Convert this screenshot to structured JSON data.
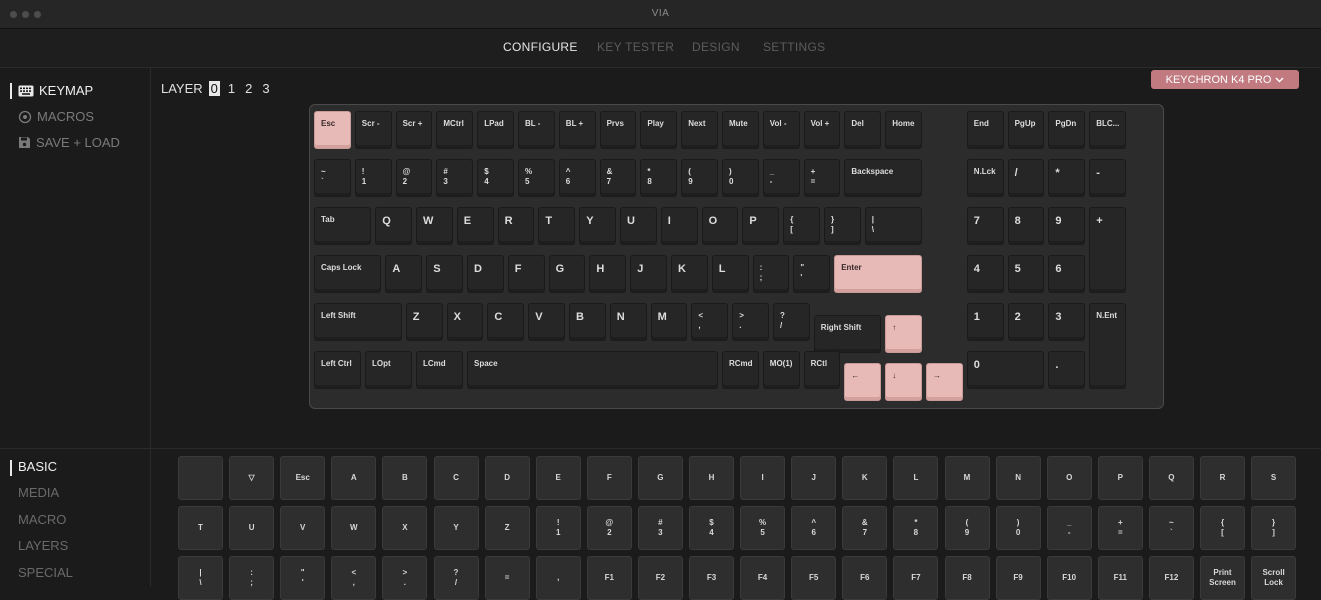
{
  "window": {
    "title": "VIA"
  },
  "nav": {
    "tabs": [
      "CONFIGURE",
      "KEY TESTER",
      "DESIGN",
      "SETTINGS"
    ],
    "active": "CONFIGURE"
  },
  "sidebar": {
    "items": [
      {
        "label": "KEYMAP",
        "icon": "keyboard-icon",
        "active": true
      },
      {
        "label": "MACROS",
        "icon": "target-circle-icon",
        "active": false
      },
      {
        "label": "SAVE + LOAD",
        "icon": "floppy-disk-icon",
        "active": false
      }
    ]
  },
  "layers": {
    "label": "LAYER",
    "items": [
      "0",
      "1",
      "2",
      "3"
    ],
    "active": "0"
  },
  "device": {
    "name": "KEYCHRON K4 PRO",
    "icon": "chevron-down-icon"
  },
  "colors": {
    "accent_pink": "#e7bab7",
    "device_button": "#c07a80",
    "background": "#1b1b1b"
  },
  "keyboard": {
    "rows": [
      [
        "Esc",
        "Scr -",
        "Scr +",
        "MCtrl",
        "LPad",
        "BL -",
        "BL +",
        "Prvs",
        "Play",
        "Next",
        "Mute",
        "Vol -",
        "Vol +",
        "Del",
        "Home",
        "End",
        "PgUp",
        "PgDn",
        "BLC..."
      ],
      [
        "~\n`",
        "!\n1",
        "@\n2",
        "#\n3",
        "$\n4",
        "%\n5",
        "^\n6",
        "&\n7",
        "*\n8",
        "(\n9",
        ")\n0",
        "_\n-",
        "+\n=",
        "Backspace",
        "N.Lck",
        "/",
        "*",
        "-"
      ],
      [
        "Tab",
        "Q",
        "W",
        "E",
        "R",
        "T",
        "Y",
        "U",
        "I",
        "O",
        "P",
        "{\n[",
        "}\n]",
        "|\n\\",
        "7",
        "8",
        "9",
        "+"
      ],
      [
        "Caps Lock",
        "A",
        "S",
        "D",
        "F",
        "G",
        "H",
        "J",
        "K",
        "L",
        ":\n;",
        "\"\n'",
        "Enter",
        "4",
        "5",
        "6"
      ],
      [
        "Left Shift",
        "Z",
        "X",
        "C",
        "V",
        "B",
        "N",
        "M",
        "<\n,",
        ">\n.",
        "?\n/",
        "Right Shift",
        "↑",
        "1",
        "2",
        "3",
        "N.Ent"
      ],
      [
        "Left Ctrl",
        "LOpt",
        "LCmd",
        "Space",
        "RCmd",
        "MO(1)",
        "RCtl",
        "←",
        "↓",
        "→",
        "0",
        "."
      ]
    ]
  },
  "picker": {
    "categories": [
      "BASIC",
      "MEDIA",
      "MACRO",
      "LAYERS",
      "SPECIAL"
    ],
    "active": "BASIC",
    "rows": [
      [
        "",
        "▽",
        "Esc",
        "A",
        "B",
        "C",
        "D",
        "E",
        "F",
        "G",
        "H",
        "I",
        "J",
        "K",
        "L",
        "M",
        "N",
        "O",
        "P",
        "Q",
        "R",
        "S"
      ],
      [
        "T",
        "U",
        "V",
        "W",
        "X",
        "Y",
        "Z",
        "!\n1",
        "@\n2",
        "#\n3",
        "$\n4",
        "%\n5",
        "^\n6",
        "&\n7",
        "*\n8",
        "(\n9",
        ")\n0",
        "_\n-",
        "+\n=",
        "~\n`",
        "{\n[",
        "}\n]"
      ],
      [
        "|\n\\",
        ":\n;",
        "\"\n'",
        "<\n,",
        ">\n.",
        "?\n/",
        "=",
        ",",
        "F1",
        "F2",
        "F3",
        "F4",
        "F5",
        "F6",
        "F7",
        "F8",
        "F9",
        "F10",
        "F11",
        "F12",
        "Print\nScreen",
        "Scroll\nLock"
      ]
    ]
  }
}
